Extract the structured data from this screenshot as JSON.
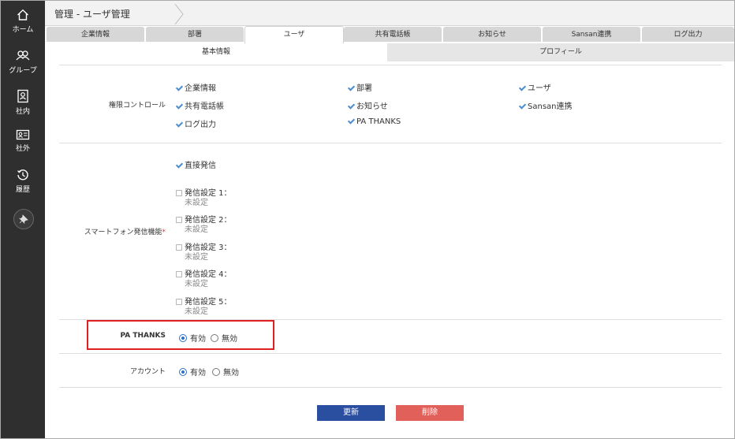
{
  "sidebar": {
    "items": [
      {
        "label": "ホーム",
        "icon": "home-icon"
      },
      {
        "label": "グループ",
        "icon": "group-icon"
      },
      {
        "label": "社内",
        "icon": "internal-contact-icon"
      },
      {
        "label": "社外",
        "icon": "external-card-icon"
      },
      {
        "label": "履歴",
        "icon": "history-icon"
      }
    ],
    "pin_icon": "pin-icon"
  },
  "header": {
    "title": "管理 - ユーザ管理"
  },
  "tabs": [
    "企業情報",
    "部署",
    "ユーザ",
    "共有電話帳",
    "お知らせ",
    "Sansan連携",
    "ログ出力"
  ],
  "active_tab": "ユーザ",
  "subtabs": [
    "基本情報",
    "プロフィール"
  ],
  "permission": {
    "label": "権限コントロール",
    "options": [
      {
        "label": "企業情報",
        "checked": true
      },
      {
        "label": "部署",
        "checked": true
      },
      {
        "label": "ユーザ",
        "checked": true
      },
      {
        "label": "共有電話帳",
        "checked": true
      },
      {
        "label": "お知らせ",
        "checked": true
      },
      {
        "label": "Sansan連携",
        "checked": true
      },
      {
        "label": "ログ出力",
        "checked": true
      },
      {
        "label": "PA THANKS",
        "checked": true
      }
    ]
  },
  "smartphone": {
    "label": "スマートフォン発信機能",
    "required_mark": "*",
    "direct": {
      "label": "直接発信",
      "checked": true
    },
    "settings": [
      {
        "label": "発信設定 1：",
        "value": "未設定",
        "checked": false
      },
      {
        "label": "発信設定 2：",
        "value": "未設定",
        "checked": false
      },
      {
        "label": "発信設定 3：",
        "value": "未設定",
        "checked": false
      },
      {
        "label": "発信設定 4：",
        "value": "未設定",
        "checked": false
      },
      {
        "label": "発信設定 5：",
        "value": "未設定",
        "checked": false
      }
    ]
  },
  "pa_thanks": {
    "label": "PA THANKS",
    "options": [
      "有効",
      "無効"
    ],
    "selected": "有効"
  },
  "account": {
    "label": "アカウント",
    "options": [
      "有効",
      "無効"
    ],
    "selected": "有効"
  },
  "buttons": {
    "update": "更新",
    "delete": "削除"
  },
  "colors": {
    "sidebar_bg": "#2f2f2f",
    "update_btn": "#2a4ea0",
    "delete_btn": "#e2605a",
    "highlight": "#e02020",
    "check": "#4a8ed0",
    "required": "#d9383a"
  }
}
